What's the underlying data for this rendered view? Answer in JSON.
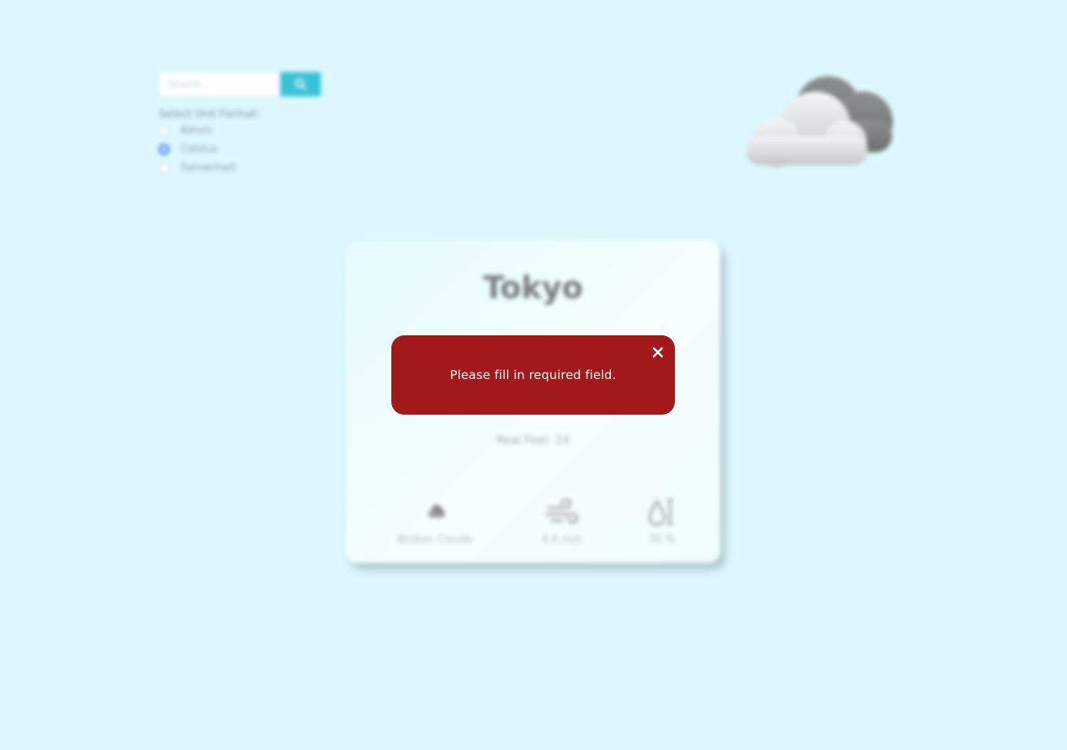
{
  "search": {
    "placeholder": "Search...",
    "button_icon": "search-icon"
  },
  "units": {
    "title": "Select Unit Format:",
    "options": [
      {
        "label": "Kelvin",
        "checked": false
      },
      {
        "label": "Celsius",
        "checked": true
      },
      {
        "label": "Fahrenheit",
        "checked": false
      }
    ]
  },
  "weather": {
    "city": "Tokyo",
    "real_feel": "Real Feel: 24",
    "conditions": "Broken Clouds",
    "wind": "4.6 m/s",
    "humidity": "70 %"
  },
  "error": {
    "message": "Please fill in required field.",
    "close_icon": "close-icon"
  },
  "colors": {
    "background": "#dcf8fd",
    "accent": "#39c2d7",
    "error": "#a3181a"
  }
}
